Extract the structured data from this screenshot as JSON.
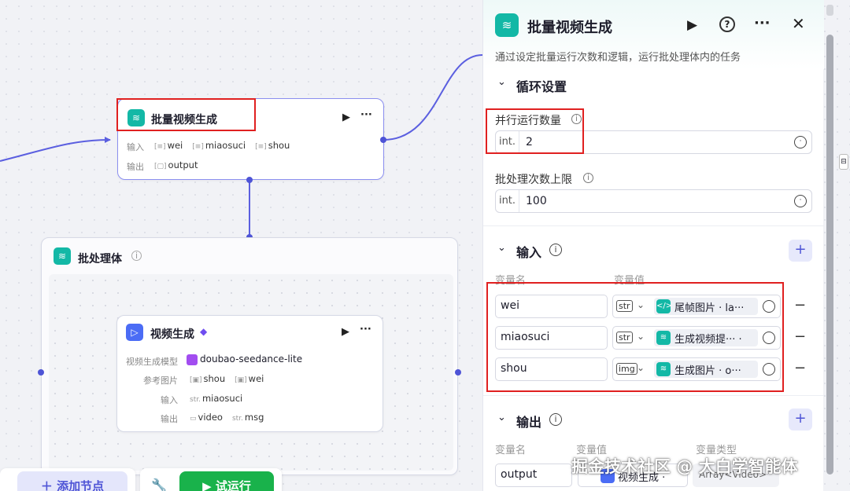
{
  "canvas": {
    "main_node": {
      "title": "批量视频生成",
      "input_label": "输入",
      "inputs": [
        "wei",
        "miaosuci",
        "shou"
      ],
      "output_label": "输出",
      "outputs": [
        "output"
      ]
    },
    "batch_body": {
      "title": "批处理体"
    },
    "video_node": {
      "title": "视频生成",
      "model_label": "视频生成模型",
      "model": "doubao-seedance-lite",
      "ref_label": "参考图片",
      "refs": [
        "shou",
        "wei"
      ],
      "input_label": "输入",
      "input_type": "str.",
      "inputs": [
        "miaosuci"
      ],
      "output_label": "输出",
      "outputs": [
        "video",
        "msg"
      ],
      "output_types": [
        "",
        "str."
      ]
    },
    "add_node_label": "添加节点",
    "test_run_label": "试运行"
  },
  "panel": {
    "title": "批量视频生成",
    "description": "通过设定批量运行次数和逻辑，运行批处理体内的任务",
    "loop_section": "循环设置",
    "concurrency": {
      "label": "并行运行数量",
      "type": "int.",
      "value": "2"
    },
    "batch_limit": {
      "label": "批处理次数上限",
      "type": "int.",
      "value": "100"
    },
    "input_section": "输入",
    "var_name_header": "变量名",
    "var_value_header": "变量值",
    "inputs": [
      {
        "name": "wei",
        "type": "str",
        "ref": "尾帧图片 · la···"
      },
      {
        "name": "miaosuci",
        "type": "str",
        "ref": "生成视频提··· ·"
      },
      {
        "name": "shou",
        "type": "img",
        "ref": "生成图片 · o···"
      }
    ],
    "output_section": "输出",
    "out_name_header": "变量名",
    "out_value_header": "变量值",
    "out_type_header": "变量类型",
    "outputs": [
      {
        "name": "output",
        "ref": "视频生成 ·",
        "type": "Array<Video>"
      }
    ]
  },
  "watermark": "掘金技术社区 @ 大白学智能体",
  "colors": {
    "accent": "#4e54d6",
    "teal": "#13b8a6",
    "run_green": "#19b24b",
    "highlight": "#e02020"
  }
}
